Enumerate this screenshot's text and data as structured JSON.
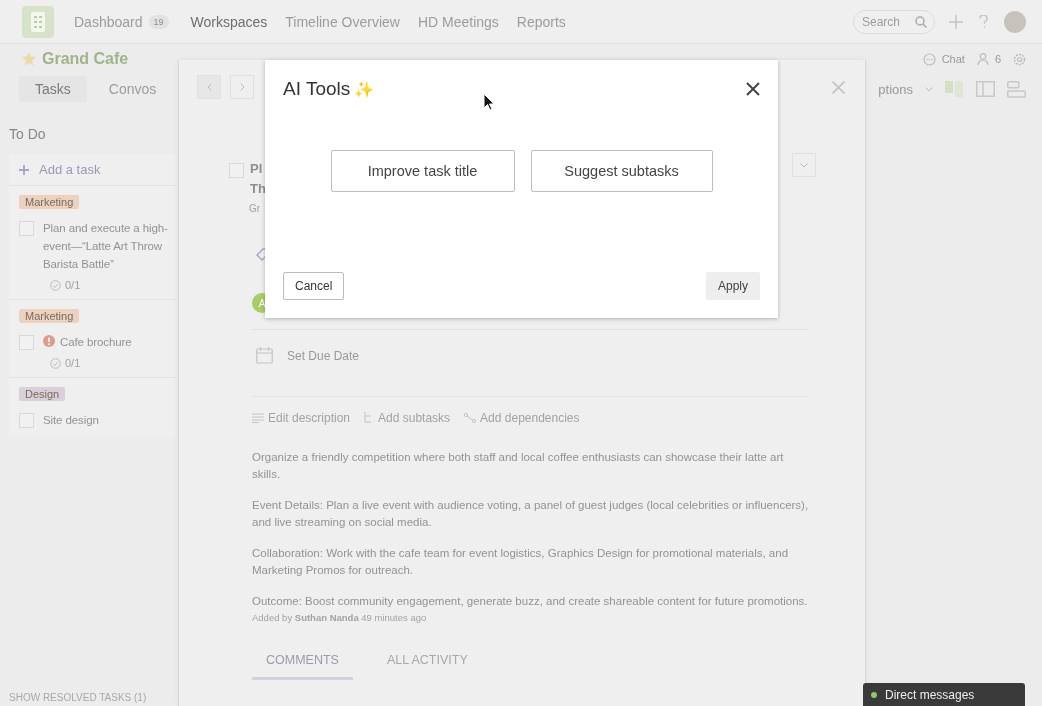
{
  "nav": {
    "items": [
      {
        "label": "Dashboard",
        "badge": "19",
        "selected": false
      },
      {
        "label": "Workspaces",
        "selected": true
      },
      {
        "label": "Timeline Overview",
        "selected": false
      },
      {
        "label": "HD Meetings",
        "selected": false
      },
      {
        "label": "Reports",
        "selected": false
      }
    ],
    "search_placeholder": "Search"
  },
  "workspace": {
    "title": "Grand Cafe",
    "starred": true,
    "chat": "Chat",
    "members": "6",
    "options": "ptions",
    "tabs": [
      {
        "label": "Tasks",
        "selected": true
      },
      {
        "label": "Convos",
        "selected": false
      }
    ]
  },
  "column": {
    "title": "To Do",
    "add_task": "Add a task",
    "show_resolved": "SHOW RESOLVED TASKS (1)",
    "tasks": [
      {
        "tag": {
          "label": "Marketing",
          "color": "#ecd2be"
        },
        "checked": false,
        "title_lines": [
          "Plan and execute a high-",
          "event—“Latte Art Throw",
          "Barista Battle”"
        ],
        "urgent": false,
        "subtasks": "0/1"
      },
      {
        "tag": {
          "label": "Marketing",
          "color": "#ecd2be"
        },
        "checked": false,
        "title_lines": [
          "Cafe brochure"
        ],
        "urgent": true,
        "subtasks": "0/1"
      },
      {
        "tag": {
          "label": "Design",
          "color": "#d9d0d9"
        },
        "checked": false,
        "title_lines": [
          "Site design"
        ],
        "urgent": false
      }
    ]
  },
  "detail": {
    "checked": false,
    "title_lines": [
      "Pl",
      "Th"
    ],
    "meta": "Gr",
    "avatar": "A",
    "due": "Set Due Date",
    "actions": [
      {
        "kind": "description",
        "label": "Edit description"
      },
      {
        "kind": "subtasks",
        "label": "Add subtasks"
      },
      {
        "kind": "dependencies",
        "label": "Add dependencies"
      }
    ],
    "description": [
      "Organize a friendly competition where both staff and local coffee enthusiasts can showcase their latte art skills.",
      "Event Details: Plan a live event with audience voting, a panel of guest judges (local celebrities or influencers), and live streaming on social media.",
      "Collaboration: Work with the cafe team for event logistics, Graphics Design for promotional materials, and Marketing Promos for outreach.",
      "Outcome: Boost community engagement, generate buzz, and create shareable content for future promotions."
    ],
    "added_by": "Added by **Suthan Nanda** 49 minutes ago",
    "tabs": [
      {
        "label": "COMMENTS",
        "selected": true
      },
      {
        "label": "ALL ACTIVITY",
        "selected": false
      }
    ]
  },
  "modal": {
    "title": "AI Tools",
    "sparkle": "✨",
    "options": [
      "Improve task title",
      "Suggest subtasks"
    ],
    "cancel": "Cancel",
    "apply": "Apply"
  },
  "direct_messages": "Direct messages"
}
